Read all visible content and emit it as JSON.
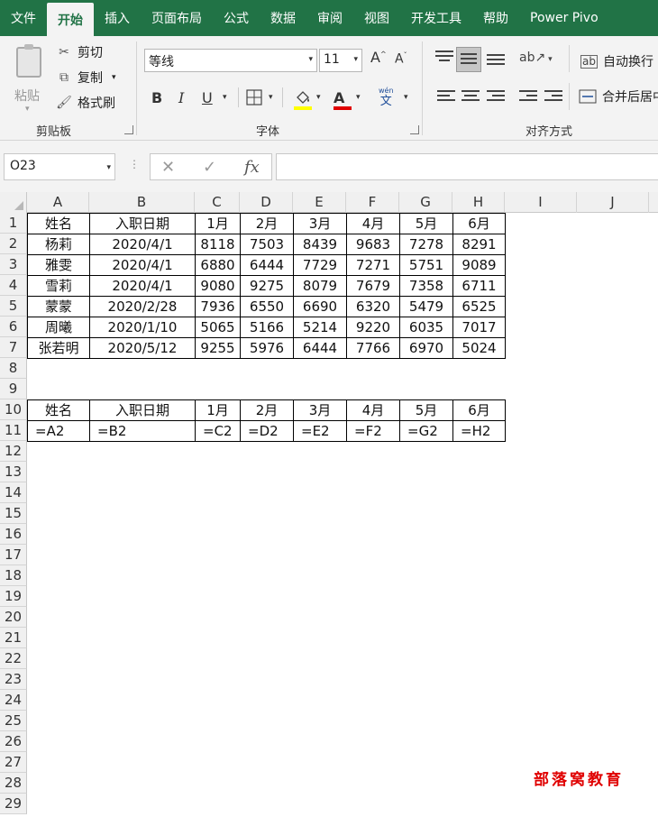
{
  "ribbon": {
    "tabs": [
      "文件",
      "开始",
      "插入",
      "页面布局",
      "公式",
      "数据",
      "审阅",
      "视图",
      "开发工具",
      "帮助",
      "Power Pivo"
    ],
    "active_tab": "开始",
    "clipboard": {
      "paste": "粘贴",
      "cut": "剪切",
      "copy": "复制",
      "format_painter": "格式刷",
      "group": "剪贴板"
    },
    "font": {
      "name": "等线",
      "size": "11",
      "grow": "A",
      "shrink": "A",
      "bold": "B",
      "italic": "I",
      "underline": "U",
      "font_color_glyph": "A",
      "phonetic_top": "wén",
      "phonetic_bottom": "文",
      "group": "字体",
      "highlight_color": "#ffff00",
      "font_color": "#e00000"
    },
    "alignment": {
      "wrap": "自动换行",
      "wrap_icon": "ab",
      "merge": "合并后居中",
      "group": "对齐方式"
    }
  },
  "formula_bar": {
    "name_box": "O23",
    "cancel": "✕",
    "enter": "✓",
    "fx": "fx",
    "formula": ""
  },
  "sheet": {
    "columns": [
      "A",
      "B",
      "C",
      "D",
      "E",
      "F",
      "G",
      "H",
      "I",
      "J"
    ],
    "rows": [
      "1",
      "2",
      "3",
      "4",
      "5",
      "6",
      "7",
      "8",
      "9",
      "10",
      "11",
      "12",
      "13",
      "14",
      "15",
      "16",
      "17",
      "18",
      "19",
      "20",
      "21",
      "22",
      "23",
      "24",
      "25",
      "26",
      "27",
      "28",
      "29"
    ],
    "table1": [
      [
        "姓名",
        "入职日期",
        "1月",
        "2月",
        "3月",
        "4月",
        "5月",
        "6月"
      ],
      [
        "杨莉",
        "2020/4/1",
        "8118",
        "7503",
        "8439",
        "9683",
        "7278",
        "8291"
      ],
      [
        "雅雯",
        "2020/4/1",
        "6880",
        "6444",
        "7729",
        "7271",
        "5751",
        "9089"
      ],
      [
        "雪莉",
        "2020/4/1",
        "9080",
        "9275",
        "8079",
        "7679",
        "7358",
        "6711"
      ],
      [
        "蒙蒙",
        "2020/2/28",
        "7936",
        "6550",
        "6690",
        "6320",
        "5479",
        "6525"
      ],
      [
        "周曦",
        "2020/1/10",
        "5065",
        "5166",
        "5214",
        "9220",
        "6035",
        "7017"
      ],
      [
        "张若明",
        "2020/5/12",
        "9255",
        "5976",
        "6444",
        "7766",
        "6970",
        "5024"
      ]
    ],
    "table2_header": [
      "姓名",
      "入职日期",
      "1月",
      "2月",
      "3月",
      "4月",
      "5月",
      "6月"
    ],
    "table2_formulas": [
      "=A2",
      "=B2",
      "=C2",
      "=D2",
      "=E2",
      "=F2",
      "=G2",
      "=H2"
    ]
  },
  "watermark": "部落窝教育",
  "colors": {
    "accent": "#217346",
    "watermark": "#e00000"
  }
}
